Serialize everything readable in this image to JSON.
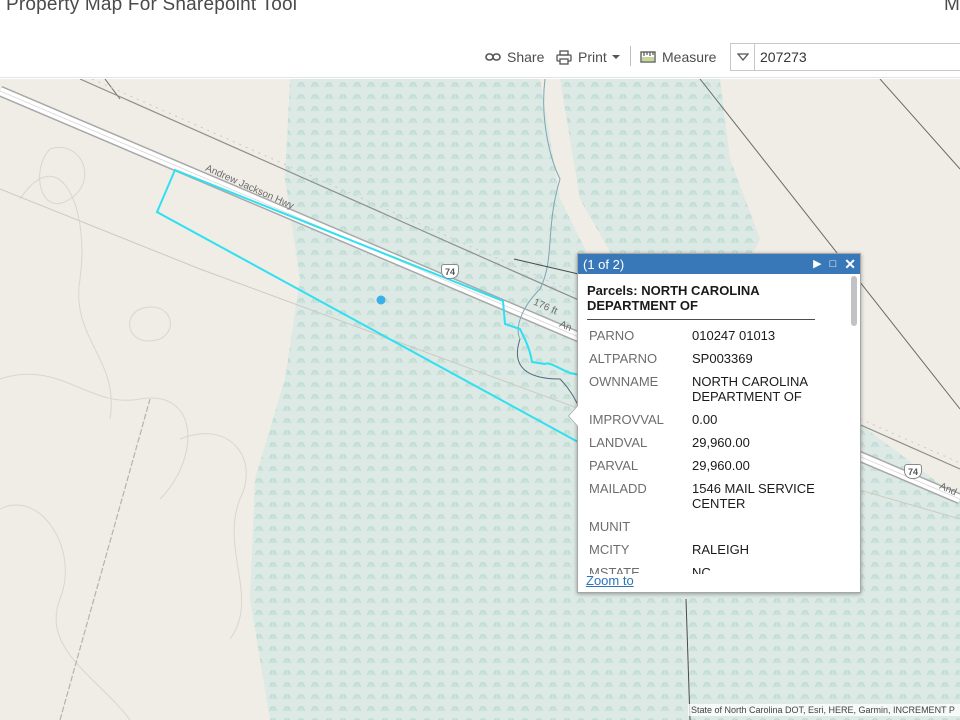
{
  "app": {
    "title": "Property Map For Sharepoint Tool",
    "header_right": "M"
  },
  "toolbar": {
    "share_label": "Share",
    "print_label": "Print",
    "measure_label": "Measure",
    "search_value": "207273"
  },
  "map": {
    "road_labels": [
      "Andrew Jackson Hwy",
      "176 ft",
      "An",
      "And"
    ],
    "shield_number": "74",
    "attribution": "State of North Carolina DOT, Esri, HERE, Garmin, INCREMENT P"
  },
  "popup": {
    "count": "(1 of 2)",
    "title": "Parcels: NORTH CAROLINA DEPARTMENT OF",
    "attributes": [
      {
        "key": "PARNO",
        "value": "010247 01013"
      },
      {
        "key": "ALTPARNO",
        "value": "SP003369"
      },
      {
        "key": "OWNNAME",
        "value": "NORTH CAROLINA DEPARTMENT OF"
      },
      {
        "key": "IMPROVVAL",
        "value": "0.00"
      },
      {
        "key": "LANDVAL",
        "value": "29,960.00"
      },
      {
        "key": "PARVAL",
        "value": "29,960.00"
      },
      {
        "key": "MAILADD",
        "value": "1546 MAIL SERVICE CENTER"
      },
      {
        "key": "MUNIT",
        "value": ""
      },
      {
        "key": "MCITY",
        "value": "RALEIGH"
      },
      {
        "key": "MSTATE",
        "value": "NC"
      }
    ],
    "zoom_label": "Zoom to"
  },
  "colors": {
    "accent": "#3878b8",
    "parcel": "#2ee0f0",
    "map_bg": "#efede6",
    "wetland": "#d7e8e3"
  }
}
